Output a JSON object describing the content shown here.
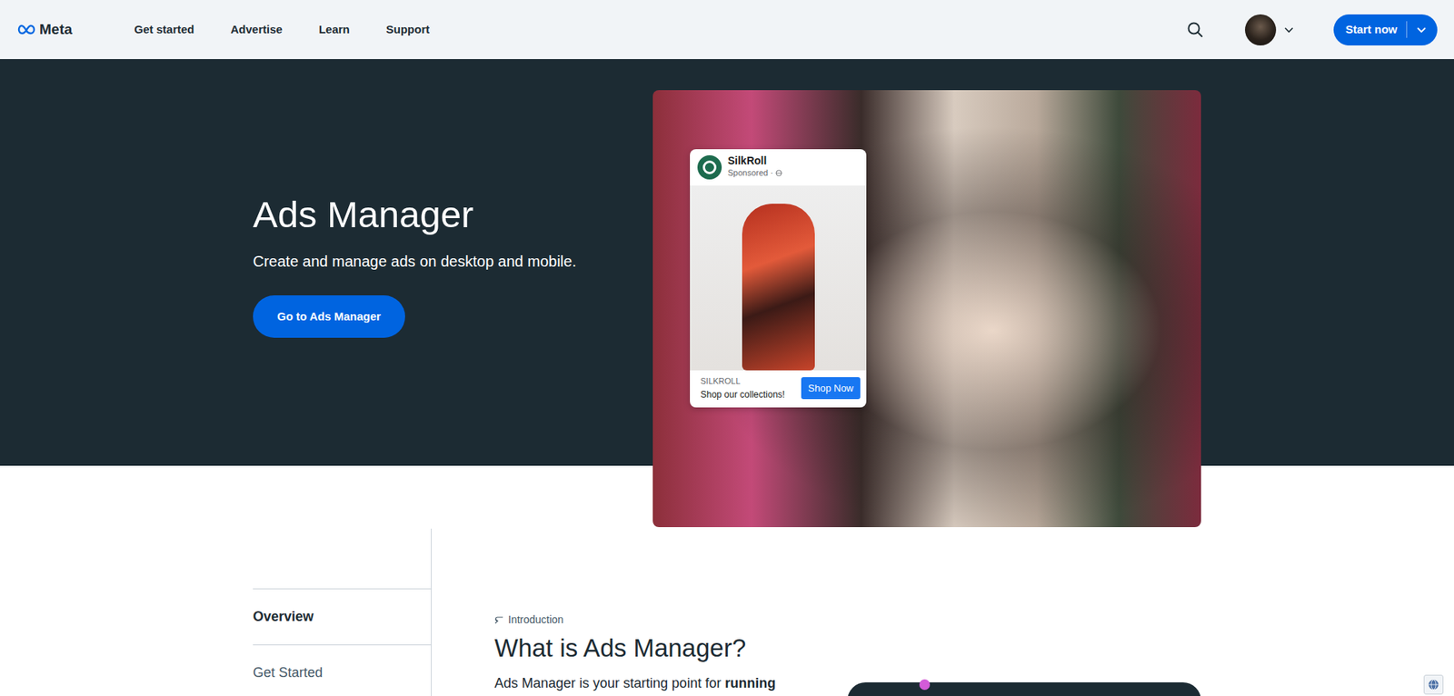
{
  "nav": {
    "logo": "Meta",
    "items": [
      "Get started",
      "Advertise",
      "Learn",
      "Support"
    ],
    "cta": "Start now"
  },
  "hero": {
    "title": "Ads Manager",
    "subtitle": "Create and manage ads on desktop and mobile.",
    "button": "Go to Ads Manager"
  },
  "ad": {
    "brand": "SilkRoll",
    "sponsored": "Sponsored ·",
    "caption_brand": "SILKROLL",
    "caption": "Shop our collections!",
    "button": "Shop Now"
  },
  "sidebar": {
    "items": [
      {
        "label": "Overview",
        "selected": true
      },
      {
        "label": "Get Started",
        "selected": false
      }
    ]
  },
  "article": {
    "eyebrow": "Introduction",
    "title": "What is Ads Manager?",
    "text": "Ads Manager is your starting point for",
    "text_bold": "running"
  }
}
